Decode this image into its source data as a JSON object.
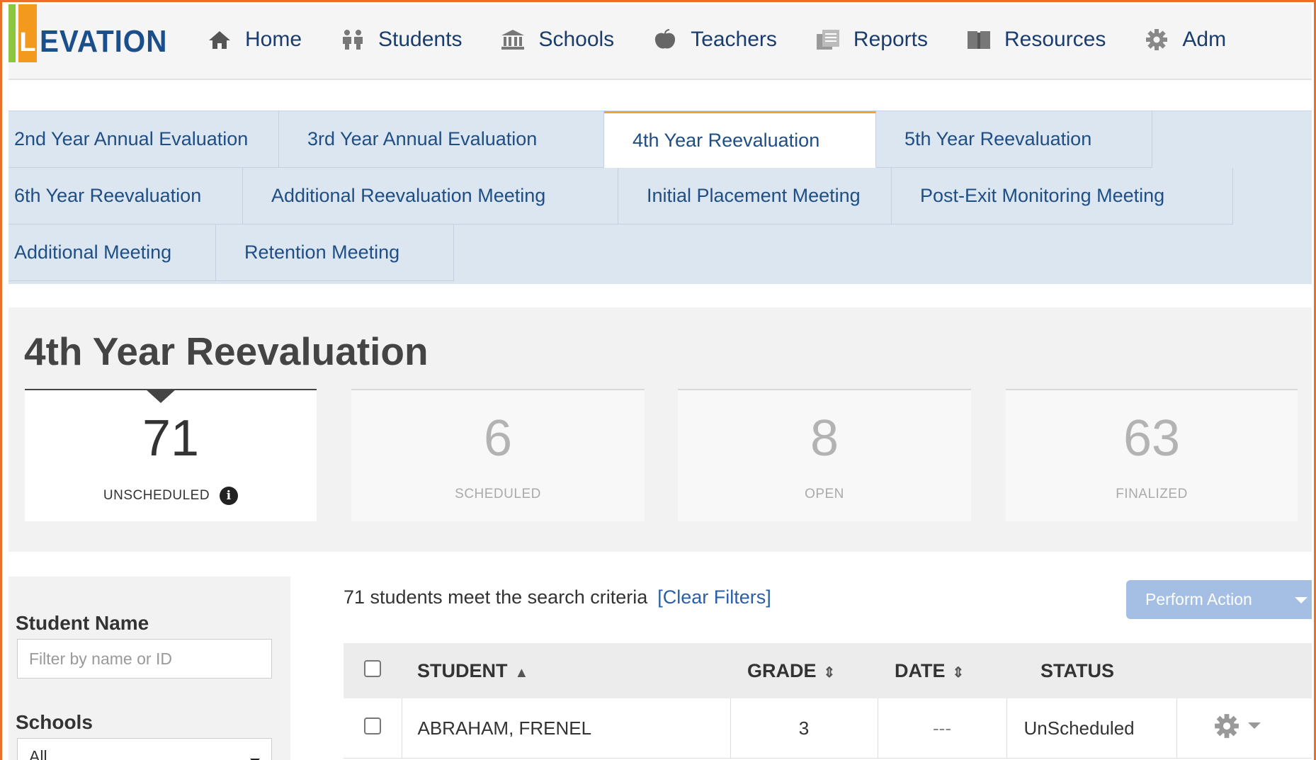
{
  "brand": {
    "mark_letter": "L",
    "text": "EVATION",
    "colors": {
      "green": "#8cc63f",
      "orange": "#f39a1e",
      "blue": "#1b4f8c"
    }
  },
  "nav": [
    {
      "label": "Home",
      "icon": "home-icon"
    },
    {
      "label": "Students",
      "icon": "students-icon"
    },
    {
      "label": "Schools",
      "icon": "school-icon"
    },
    {
      "label": "Teachers",
      "icon": "apple-icon"
    },
    {
      "label": "Reports",
      "icon": "reports-icon"
    },
    {
      "label": "Resources",
      "icon": "book-icon"
    },
    {
      "label": "Adm",
      "icon": "gear-icon"
    }
  ],
  "tabs": {
    "row1": [
      "2nd Year Annual Evaluation",
      "3rd Year Annual Evaluation",
      "4th Year Reevaluation",
      "5th Year Reevaluation"
    ],
    "row2": [
      "6th Year Reevaluation",
      "Additional Reevaluation Meeting",
      "Initial Placement Meeting",
      "Post-Exit Monitoring Meeting"
    ],
    "row3": [
      "Additional Meeting",
      "Retention Meeting"
    ],
    "active": "4th Year Reevaluation"
  },
  "page": {
    "title": "4th Year Reevaluation"
  },
  "stats": [
    {
      "value": "71",
      "label": "UNSCHEDULED",
      "active": true
    },
    {
      "value": "6",
      "label": "SCHEDULED",
      "active": false
    },
    {
      "value": "8",
      "label": "OPEN",
      "active": false
    },
    {
      "value": "63",
      "label": "FINALIZED",
      "active": false
    }
  ],
  "filters": {
    "student_name_label": "Student Name",
    "student_name_placeholder": "Filter by name or ID",
    "schools_label": "Schools",
    "schools_value": "All"
  },
  "results": {
    "count_text": "71 students meet the search criteria",
    "clear_filters": "[Clear Filters]",
    "perform_action": "Perform Action"
  },
  "table": {
    "headers": {
      "student": "STUDENT",
      "grade": "GRADE",
      "date": "DATE",
      "status": "STATUS"
    },
    "rows": [
      {
        "student": "ABRAHAM, FRENEL",
        "grade": "3",
        "date": "---",
        "status": "UnScheduled"
      }
    ]
  }
}
